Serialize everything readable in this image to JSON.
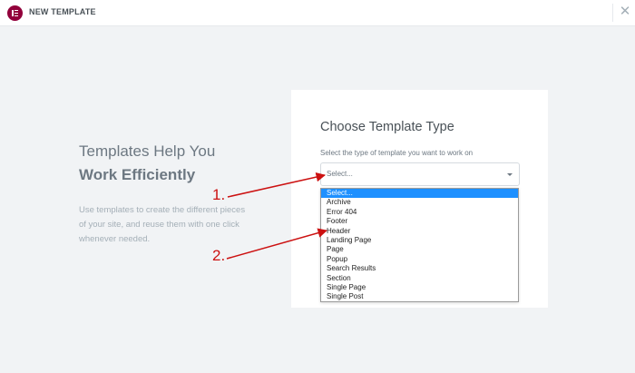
{
  "header": {
    "title": "NEW TEMPLATE",
    "close_symbol": "✕"
  },
  "intro": {
    "headline_line1": "Templates Help You",
    "headline_line2": "Work Efficiently",
    "description": "Use templates to create the different pieces of your site, and reuse them with one click whenever needed."
  },
  "form": {
    "title": "Choose Template Type",
    "label": "Select the type of template you want to work on",
    "select_value": "Select...",
    "options": [
      "Select...",
      "Archive",
      "Error 404",
      "Footer",
      "Header",
      "Landing Page",
      "Page",
      "Popup",
      "Search Results",
      "Section",
      "Single Page",
      "Single Post"
    ],
    "selected_index": 0
  },
  "annotations": {
    "step1": "1.",
    "step2": "2."
  },
  "colors": {
    "brand": "#92003b",
    "highlight": "#1e90ff",
    "annotation": "#cc1111",
    "accent_green": "#39b54a"
  }
}
